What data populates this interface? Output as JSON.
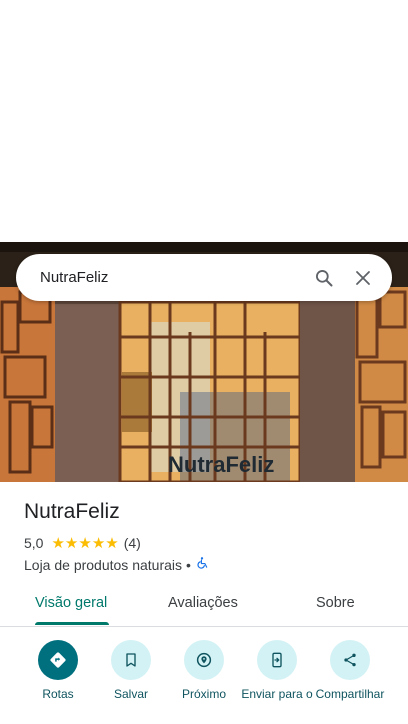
{
  "search": {
    "query": "NutraFeliz"
  },
  "photo": {
    "storefront_sign": "NutraFeliz"
  },
  "place": {
    "name": "NutraFeliz",
    "rating": "5,0",
    "stars": 5,
    "review_count": "(4)",
    "category": "Loja de produtos naturais",
    "separator": "•"
  },
  "tabs": [
    {
      "label": "Visão geral",
      "active": true
    },
    {
      "label": "Avaliações",
      "active": false
    },
    {
      "label": "Sobre",
      "active": false
    }
  ],
  "actions": [
    {
      "label": "Rotas",
      "icon": "directions-icon"
    },
    {
      "label": "Salvar",
      "icon": "bookmark-icon"
    },
    {
      "label": "Próximo",
      "icon": "nearby-icon"
    },
    {
      "label": "Enviar para o",
      "icon": "send-to-phone-icon"
    },
    {
      "label": "Compartilhar",
      "icon": "share-icon"
    }
  ],
  "colors": {
    "accent": "#00796b",
    "action_bg": "#d3f2f5",
    "action_primary": "#00707e",
    "star": "#fbbc04",
    "accessibility": "#1a73e8"
  }
}
